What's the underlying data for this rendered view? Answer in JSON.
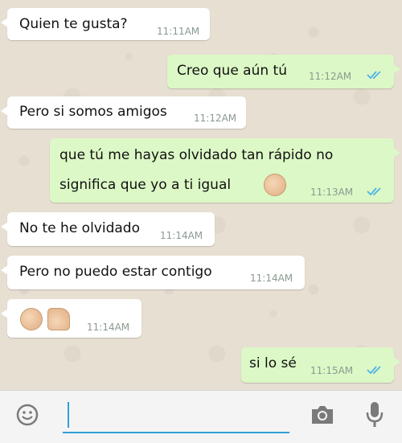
{
  "messages": [
    {
      "direction": "in",
      "text": "Quien te gusta?",
      "time": "11:11AM"
    },
    {
      "direction": "out",
      "text": "Creo que aún tú",
      "time": "11:12AM"
    },
    {
      "direction": "in",
      "text": "Pero si somos amigos",
      "time": "11:12AM"
    },
    {
      "direction": "out",
      "text_line1": "que tú me hayas olvidado tan rápido no",
      "text_line2": "significa que yo a ti igual",
      "emoji": "fist-icon",
      "time": "11:13AM"
    },
    {
      "direction": "in",
      "text": "No te he olvidado",
      "time": "11:14AM"
    },
    {
      "direction": "in",
      "text": "Pero no puedo estar contigo",
      "time": "11:14AM"
    },
    {
      "direction": "in",
      "emojis": [
        "fist-icon",
        "thumbs-up-icon"
      ],
      "time": "11:14AM"
    },
    {
      "direction": "out",
      "text": "si lo sé",
      "time": "11:15AM"
    }
  ],
  "input_bar": {
    "message_value": "",
    "icons": [
      "emoji-icon",
      "camera-icon",
      "microphone-icon"
    ]
  },
  "colors": {
    "incoming_bubble": "#ffffff",
    "outgoing_bubble": "#dcf8c6",
    "read_ticks": "#4fb3e8",
    "input_accent": "#2f9fd6"
  }
}
